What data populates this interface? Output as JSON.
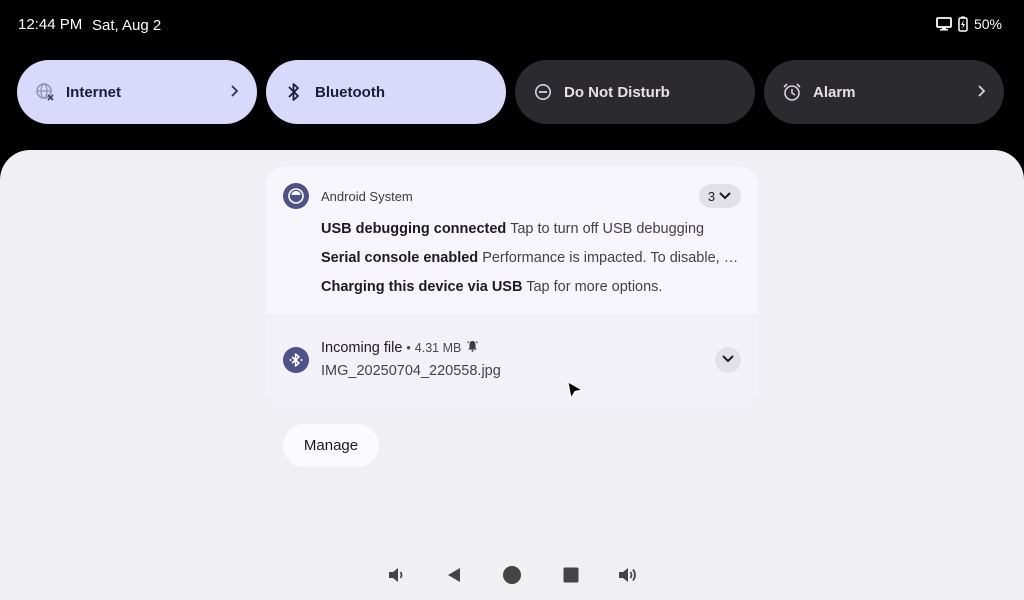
{
  "status_bar": {
    "time": "12:44 PM",
    "date": "Sat, Aug 2",
    "battery": "50%",
    "icons": [
      "monitor-icon",
      "battery-charging-icon"
    ]
  },
  "quick_settings": {
    "tiles": [
      {
        "label": "Internet",
        "icon": "globe-icon",
        "state": "on",
        "has_chevron": true
      },
      {
        "label": "Bluetooth",
        "icon": "bluetooth-icon",
        "state": "on",
        "has_chevron": false
      },
      {
        "label": "Do Not Disturb",
        "icon": "minus-circle-icon",
        "state": "off",
        "has_chevron": false
      },
      {
        "label": "Alarm",
        "icon": "alarm-clock-icon",
        "state": "off",
        "has_chevron": true
      }
    ]
  },
  "notifications": {
    "group": {
      "app_name": "Android System",
      "count": "3",
      "items": [
        {
          "title": "USB debugging connected",
          "text": "Tap to turn off USB debugging"
        },
        {
          "title": "Serial console enabled",
          "text": "Performance is impacted. To disable, check bootloader."
        },
        {
          "title": "Charging this device via USB",
          "text": "Tap for more options."
        }
      ]
    },
    "file_transfer": {
      "title": "Incoming file",
      "separator": "•",
      "size": "4.31 MB",
      "filename": "IMG_20250704_220558.jpg"
    }
  },
  "manage_label": "Manage",
  "colors": {
    "accent_tile": "#d8d9fb",
    "inactive_tile": "#2b2a2e",
    "shade_bg": "#efeff4",
    "app_icon": "#4f528a"
  },
  "nav_bar": [
    "volume-down-icon",
    "back-icon",
    "home-icon",
    "recents-icon",
    "volume-up-icon"
  ]
}
